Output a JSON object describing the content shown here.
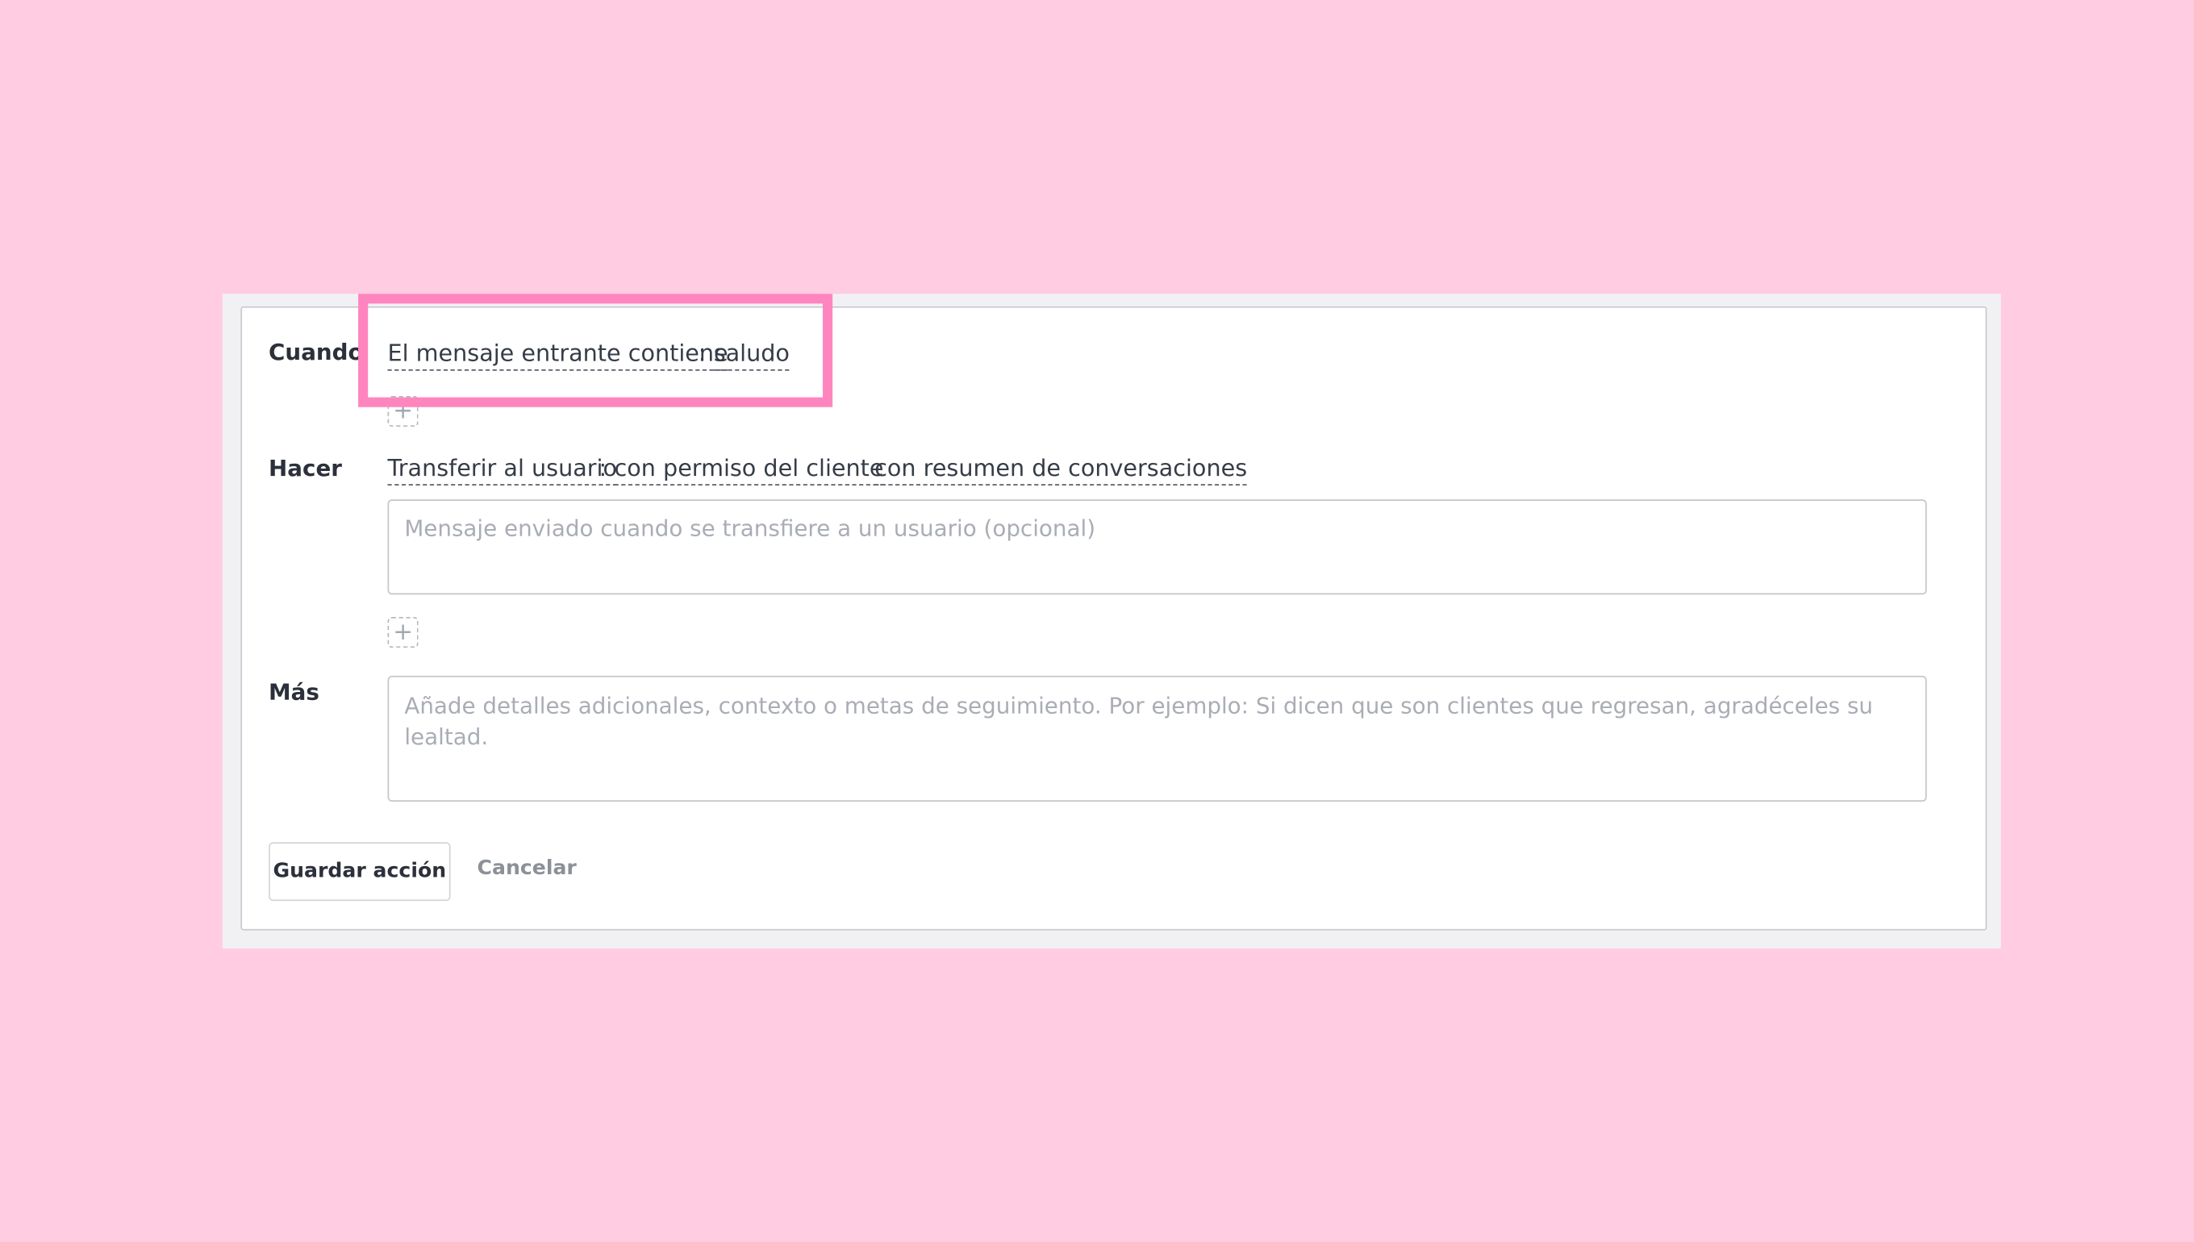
{
  "rules": {
    "when": {
      "label": "Cuando",
      "condition": "El mensaje entrante contiene",
      "value": "saludo",
      "add_label": "+"
    },
    "do": {
      "label": "Hacer",
      "action": "Transferir al usuario",
      "option1": "con permiso del cliente",
      "option2": "con resumen de conversaciones",
      "message_placeholder": "Mensaje enviado cuando se transfiere a un usuario (opcional)",
      "message_value": "",
      "add_label": "+"
    },
    "more": {
      "label": "Más",
      "placeholder": "Añade detalles adicionales, contexto o metas de seguimiento. Por ejemplo: Si dicen que son clientes que regresan, agradéceles su lealtad.",
      "value": ""
    },
    "colon": ":"
  },
  "buttons": {
    "save": "Guardar acción",
    "cancel": "Cancelar"
  },
  "colors": {
    "background": "#ffcce1",
    "highlight": "#ff85bf",
    "card_border": "#c8cbd1"
  }
}
